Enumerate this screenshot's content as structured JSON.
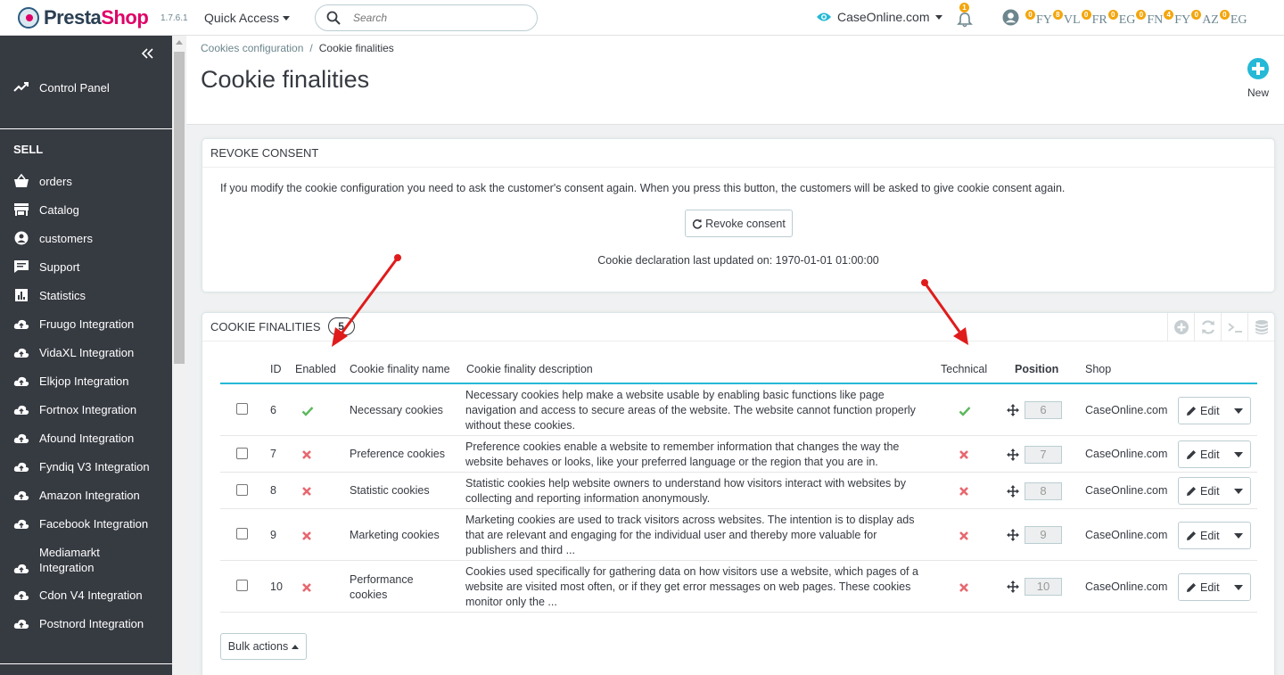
{
  "header": {
    "logo_prefix": "Presta",
    "logo_suffix": "Shop",
    "version": "1.7.6.1",
    "quick_access": "Quick Access",
    "search_placeholder": "Search",
    "shop_name": "CaseOnline.com",
    "notification_count": "1",
    "order_counters": [
      {
        "count": "0",
        "code": "FY"
      },
      {
        "count": "8",
        "code": "VL"
      },
      {
        "count": "0",
        "code": "FR"
      },
      {
        "count": "0",
        "code": "EG"
      },
      {
        "count": "0",
        "code": "FN"
      },
      {
        "count": "4",
        "code": "FY"
      },
      {
        "count": "0",
        "code": "AZ"
      },
      {
        "count": "0",
        "code": "EG"
      }
    ],
    "accent_color": "#25b9d7",
    "brand_color": "#df0067"
  },
  "sidebar": {
    "control_panel": "Control Panel",
    "section": "SELL",
    "items": [
      {
        "label": "orders",
        "icon": "basket-icon"
      },
      {
        "label": "Catalog",
        "icon": "store-icon"
      },
      {
        "label": "customers",
        "icon": "account-circle-icon"
      },
      {
        "label": "Support",
        "icon": "chat-icon"
      },
      {
        "label": "Statistics",
        "icon": "bar-chart-icon"
      },
      {
        "label": "Fruugo Integration",
        "icon": "cloud-upload-icon"
      },
      {
        "label": "VidaXL Integration",
        "icon": "cloud-upload-icon"
      },
      {
        "label": "Elkjop Integration",
        "icon": "cloud-upload-icon"
      },
      {
        "label": "Fortnox Integration",
        "icon": "cloud-upload-icon"
      },
      {
        "label": "Afound Integration",
        "icon": "cloud-upload-icon"
      },
      {
        "label": "Fyndiq V3 Integration",
        "icon": "cloud-upload-icon"
      },
      {
        "label": "Amazon Integration",
        "icon": "cloud-upload-icon"
      },
      {
        "label": "Facebook Integration",
        "icon": "cloud-upload-icon"
      },
      {
        "label": "Mediamarkt Integration",
        "icon": "cloud-upload-icon"
      },
      {
        "label": "Cdon V4 Integration",
        "icon": "cloud-upload-icon"
      },
      {
        "label": "Postnord Integration",
        "icon": "cloud-upload-icon"
      }
    ]
  },
  "page": {
    "breadcrumb_parent": "Cookies configuration",
    "breadcrumb_current": "Cookie finalities",
    "title": "Cookie finalities",
    "new_label": "New"
  },
  "revoke": {
    "heading": "REVOKE CONSENT",
    "text": "If you modify the cookie configuration you need to ask the customer's consent again. When you press this button, the customers will be asked to give cookie consent again.",
    "button": "Revoke consent",
    "updated": "Cookie declaration last updated on: 1970-01-01 01:00:00"
  },
  "list": {
    "heading": "COOKIE FINALITIES",
    "count": "5",
    "columns": {
      "id": "ID",
      "enabled": "Enabled",
      "name": "Cookie finality name",
      "description": "Cookie finality description",
      "technical": "Technical",
      "position": "Position",
      "shop": "Shop"
    },
    "edit_label": "Edit",
    "bulk_label": "Bulk actions",
    "rows": [
      {
        "id": "6",
        "enabled": true,
        "name": "Necessary cookies",
        "description": "Necessary cookies help make a website usable by enabling basic functions like page navigation and access to secure areas of the website. The website cannot function properly without these cookies.",
        "technical": true,
        "position": "6",
        "shop": "CaseOnline.com"
      },
      {
        "id": "7",
        "enabled": false,
        "name": "Preference cookies",
        "description": "Preference cookies enable a website to remember information that changes the way the website behaves or looks, like your preferred language or the region that you are in.",
        "technical": false,
        "position": "7",
        "shop": "CaseOnline.com"
      },
      {
        "id": "8",
        "enabled": false,
        "name": "Statistic cookies",
        "description": "Statistic cookies help website owners to understand how visitors interact with websites by collecting and reporting information anonymously.",
        "technical": false,
        "position": "8",
        "shop": "CaseOnline.com"
      },
      {
        "id": "9",
        "enabled": false,
        "name": "Marketing cookies",
        "description": "Marketing cookies are used to track visitors across websites. The intention is to display ads that are relevant and engaging for the individual user and thereby more valuable for publishers and third ...",
        "technical": false,
        "position": "9",
        "shop": "CaseOnline.com"
      },
      {
        "id": "10",
        "enabled": false,
        "name": "Performance cookies",
        "description": "Cookies used specifically for gathering data on how visitors use a website, which pages of a website are visited most often, or if they get error messages on web pages. These cookies monitor only the ...",
        "technical": false,
        "position": "10",
        "shop": "CaseOnline.com"
      }
    ]
  },
  "annotation_color": "#e01b1b"
}
